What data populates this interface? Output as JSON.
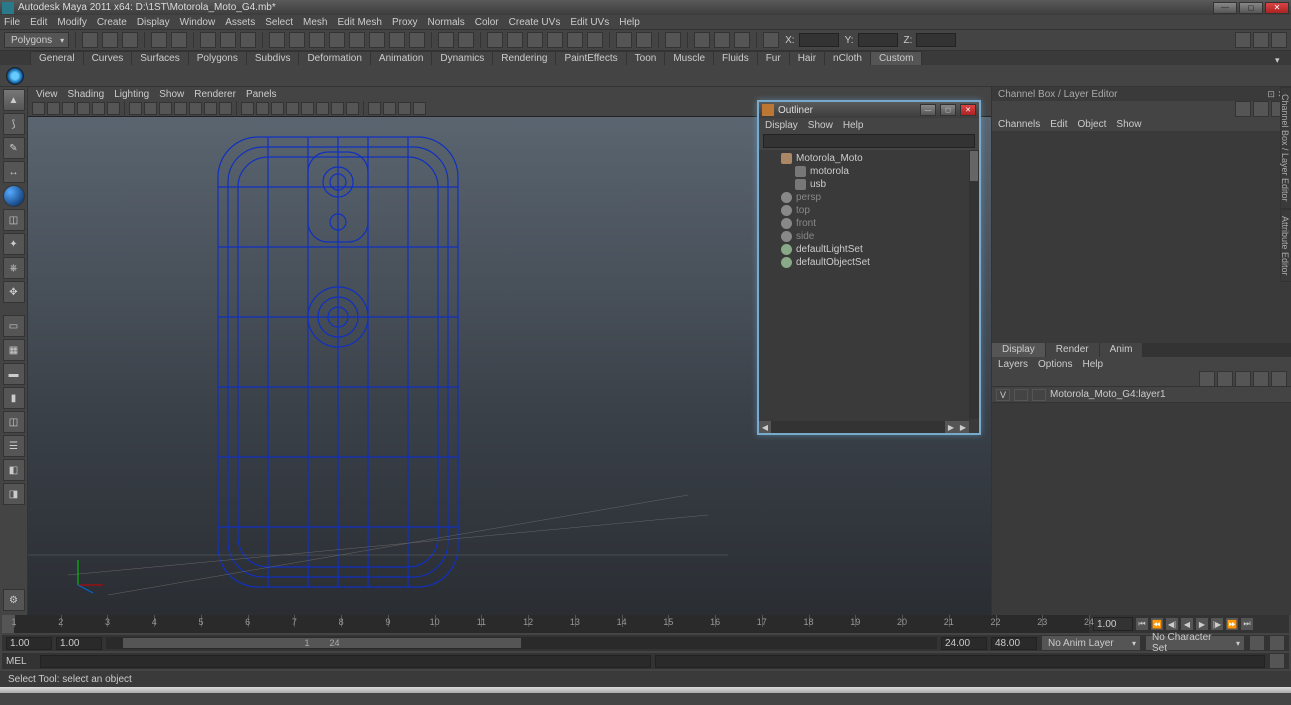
{
  "titlebar": {
    "text": "Autodesk Maya 2011 x64: D:\\1ST\\Motorola_Moto_G4.mb*"
  },
  "menu": [
    "File",
    "Edit",
    "Modify",
    "Create",
    "Display",
    "Window",
    "Assets",
    "Select",
    "Mesh",
    "Edit Mesh",
    "Proxy",
    "Normals",
    "Color",
    "Create UVs",
    "Edit UVs",
    "Help"
  ],
  "mode_dropdown": "Polygons",
  "coords": {
    "x_label": "X:",
    "y_label": "Y:",
    "z_label": "Z:"
  },
  "shelf_tabs": [
    "General",
    "Curves",
    "Surfaces",
    "Polygons",
    "Subdivs",
    "Deformation",
    "Animation",
    "Dynamics",
    "Rendering",
    "PaintEffects",
    "Toon",
    "Muscle",
    "Fluids",
    "Fur",
    "Hair",
    "nCloth",
    "Custom"
  ],
  "active_shelf": "Custom",
  "viewport_menu": [
    "View",
    "Shading",
    "Lighting",
    "Show",
    "Renderer",
    "Panels"
  ],
  "outliner": {
    "title": "Outliner",
    "menu": [
      "Display",
      "Show",
      "Help"
    ],
    "items": [
      {
        "label": "Motorola_Moto",
        "type": "grp",
        "indent": 0,
        "dim": false
      },
      {
        "label": "motorola",
        "type": "mesh",
        "indent": 1,
        "dim": false
      },
      {
        "label": "usb",
        "type": "mesh",
        "indent": 1,
        "dim": false
      },
      {
        "label": "persp",
        "type": "cam",
        "indent": 0,
        "dim": true
      },
      {
        "label": "top",
        "type": "cam",
        "indent": 0,
        "dim": true
      },
      {
        "label": "front",
        "type": "cam",
        "indent": 0,
        "dim": true
      },
      {
        "label": "side",
        "type": "cam",
        "indent": 0,
        "dim": true
      },
      {
        "label": "defaultLightSet",
        "type": "set",
        "indent": 0,
        "dim": false
      },
      {
        "label": "defaultObjectSet",
        "type": "set",
        "indent": 0,
        "dim": false
      }
    ]
  },
  "rightpanel": {
    "title": "Channel Box / Layer Editor",
    "menu": [
      "Channels",
      "Edit",
      "Object",
      "Show"
    ],
    "tabs": [
      "Display",
      "Render",
      "Anim"
    ],
    "active_tab": "Display",
    "submenu": [
      "Layers",
      "Options",
      "Help"
    ],
    "layer": {
      "vis": "V",
      "name": "Motorola_Moto_G4:layer1"
    },
    "vert_tabs": [
      "Channel Box / Layer Editor",
      "Attribute Editor"
    ]
  },
  "timeline": {
    "current": "1.00",
    "play_btns": [
      "⏮",
      "⏪",
      "◀|",
      "◀",
      "▶",
      "|▶",
      "⏩",
      "⏭"
    ]
  },
  "range": {
    "start_outer": "1.00",
    "start_inner": "1.00",
    "range_label_a": "1",
    "range_label_b": "24",
    "end_inner": "24.00",
    "end_outer": "48.00",
    "anim_layer": "No Anim Layer",
    "char_set": "No Character Set"
  },
  "cmd": {
    "label": "MEL"
  },
  "help": "Select Tool: select an object"
}
